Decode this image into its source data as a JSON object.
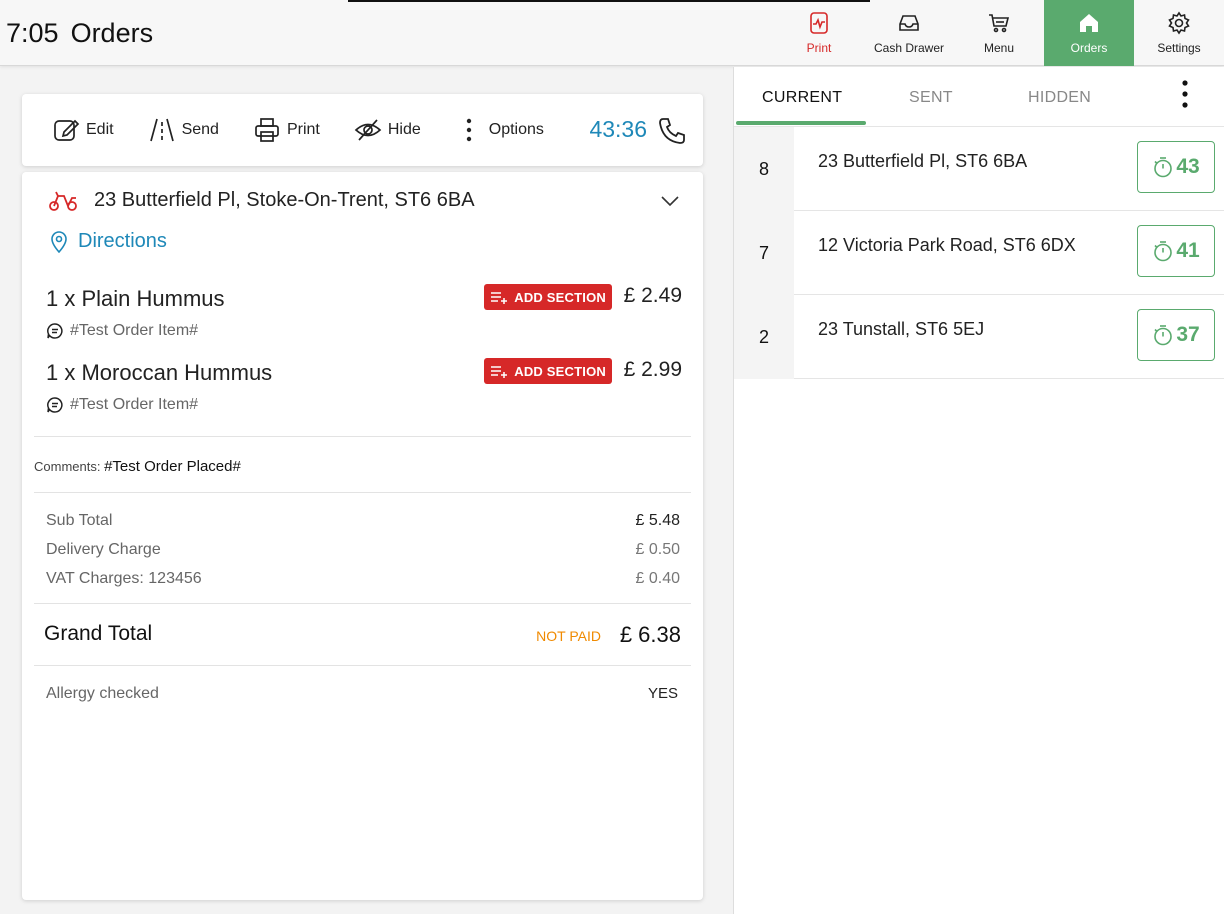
{
  "header": {
    "time": "7:05",
    "title": "Orders"
  },
  "nav": [
    {
      "label": "Print",
      "icon": "print-icon"
    },
    {
      "label": "Cash Drawer",
      "icon": "cash-drawer-icon"
    },
    {
      "label": "Menu",
      "icon": "cart-icon"
    },
    {
      "label": "Orders",
      "icon": "home-icon"
    },
    {
      "label": "Settings",
      "icon": "gear-icon"
    }
  ],
  "toolbar": {
    "edit": "Edit",
    "send": "Send",
    "print": "Print",
    "hide": "Hide",
    "options": "Options",
    "timer": "43:36"
  },
  "order": {
    "address": "23 Butterfield Pl, Stoke-On-Trent, ST6 6BA",
    "directions": "Directions",
    "items": [
      {
        "qty_name": "1 x  Plain Hummus",
        "add_section": "ADD SECTION",
        "price": "£ 2.49",
        "note": "#Test Order Item#"
      },
      {
        "qty_name": "1 x  Moroccan Hummus",
        "add_section": "ADD SECTION",
        "price": "£ 2.99",
        "note": "#Test Order Item#"
      }
    ],
    "comments_label": "Comments:",
    "comments_value": "#Test Order Placed#",
    "sub_total_label": "Sub Total",
    "sub_total": "£ 5.48",
    "delivery_label": "Delivery Charge",
    "delivery": "£ 0.50",
    "vat_label": "VAT Charges: 123456",
    "vat": "£ 0.40",
    "grand_total_label": "Grand Total",
    "payment_status": "NOT PAID",
    "grand_total": "£ 6.38",
    "allergy_label": "Allergy checked",
    "allergy_value": "YES"
  },
  "tabs": {
    "current": "CURRENT",
    "sent": "SENT",
    "hidden": "HIDDEN"
  },
  "orders_list": [
    {
      "num": "8",
      "address": "23 Butterfield Pl, ST6 6BA",
      "minutes": "43"
    },
    {
      "num": "7",
      "address": "12 Victoria Park Road, ST6 6DX",
      "minutes": "41"
    },
    {
      "num": "2",
      "address": "23 Tunstall, ST6 5EJ",
      "minutes": "37"
    }
  ],
  "colors": {
    "accent_green": "#5aaa6e",
    "alert_red": "#d62828",
    "link_blue": "#1e88b8",
    "warning_orange": "#f08a00"
  }
}
